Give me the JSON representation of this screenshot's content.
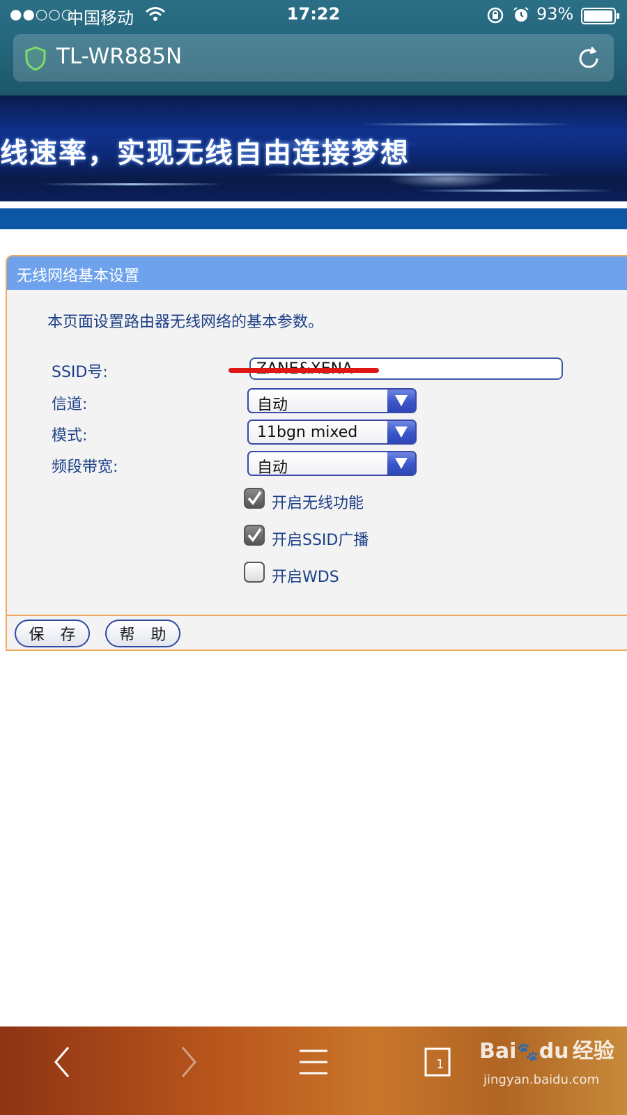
{
  "status_bar": {
    "signal": "●●○○○",
    "carrier": "中国移动",
    "time": "17:22",
    "battery_percent": "93%",
    "icons": [
      "wifi-icon",
      "rotation-lock-icon",
      "alarm-icon",
      "battery-icon"
    ]
  },
  "address_bar": {
    "title": "TL-WR885N",
    "icons": [
      "shield-icon",
      "reload-icon"
    ]
  },
  "banner": {
    "slogan": "线速率，实现无线自由连接梦想"
  },
  "panel": {
    "title": "无线网络基本设置",
    "description": "本页面设置路由器无线网络的基本参数。",
    "fields": {
      "ssid": {
        "label": "SSID号:",
        "value": "ZANE&XENA"
      },
      "channel": {
        "label": "信道:",
        "value": "自动"
      },
      "mode": {
        "label": "模式:",
        "value": "11bgn mixed"
      },
      "bandwidth": {
        "label": "频段带宽:",
        "value": "自动"
      }
    },
    "checkboxes": [
      {
        "label": "开启无线功能",
        "checked": true
      },
      {
        "label": "开启SSID广播",
        "checked": true
      },
      {
        "label": "开启WDS",
        "checked": false
      }
    ],
    "buttons": {
      "save": "保 存",
      "help": "帮 助"
    }
  },
  "toolbar": {
    "icons": [
      "back-icon",
      "forward-icon",
      "menu-icon",
      "tabs-icon"
    ],
    "tabs_count": "1"
  },
  "watermark": {
    "logo": "Bai",
    "logo_suffix": "du",
    "brand_cn": "经验",
    "url": "jingyan.baidu.com"
  },
  "colors": {
    "panel_header": "#6ea2ec",
    "panel_border": "#f0a860",
    "label_text": "#1b3f86",
    "redaction": "#e01515"
  }
}
